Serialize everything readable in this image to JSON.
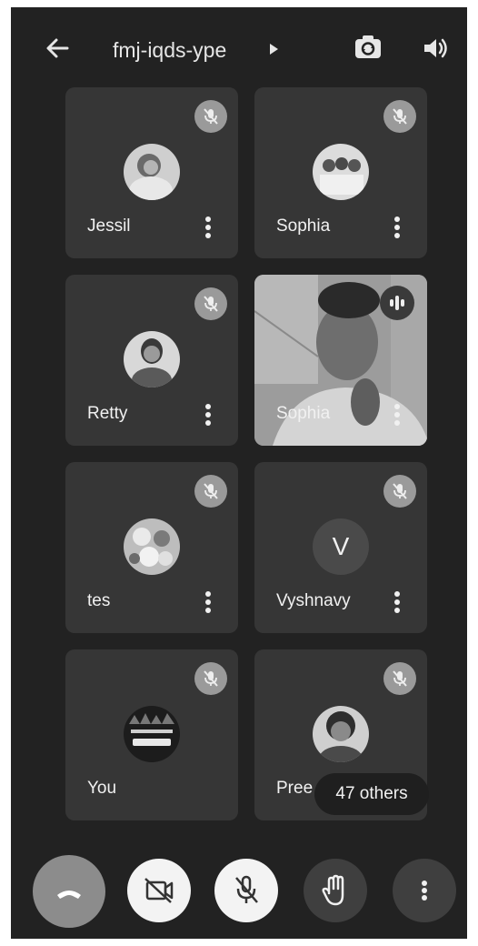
{
  "header": {
    "meeting_code": "fmj-iqds-ype"
  },
  "icons": {
    "back": "arrow-left-icon",
    "title_caret": "caret-right-icon",
    "switch_camera": "switch-camera-icon",
    "speaker": "speaker-icon",
    "muted": "mic-off-icon",
    "speaking": "audio-wave-icon",
    "more": "more-vertical-icon",
    "end_call": "phone-hangup-icon",
    "camera_off": "camera-off-icon",
    "mic_off": "mic-off-icon",
    "raise_hand": "hand-icon"
  },
  "participants": [
    {
      "name": "Jessil"
    },
    {
      "name": "Sophia"
    },
    {
      "name": "Retty"
    },
    {
      "name": "Sophia"
    },
    {
      "name": "tes"
    },
    {
      "name": "Vyshnavy",
      "initial": "V"
    },
    {
      "name": "You"
    },
    {
      "name": "Pree"
    }
  ],
  "others_count_label": "47 others",
  "colors": {
    "background": "#222222",
    "tile": "#363636",
    "end_call": "#8c8c8c"
  }
}
